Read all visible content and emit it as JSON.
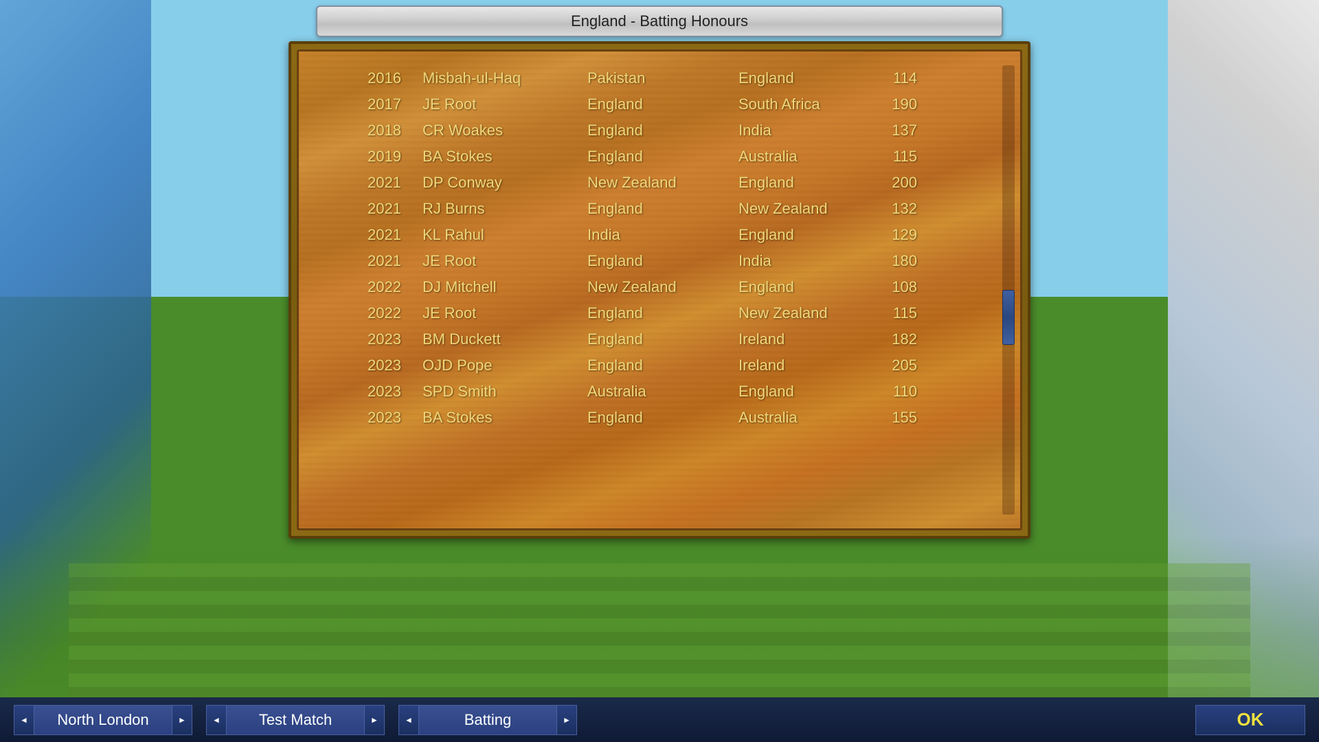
{
  "title": "England - Batting Honours",
  "records": [
    {
      "year": "2016",
      "player": "Misbah-ul-Haq",
      "team1": "Pakistan",
      "team2": "England",
      "score": "114"
    },
    {
      "year": "2017",
      "player": "JE Root",
      "team1": "England",
      "team2": "South Africa",
      "score": "190"
    },
    {
      "year": "2018",
      "player": "CR Woakes",
      "team1": "England",
      "team2": "India",
      "score": "137"
    },
    {
      "year": "2019",
      "player": "BA Stokes",
      "team1": "England",
      "team2": "Australia",
      "score": "115"
    },
    {
      "year": "2021",
      "player": "DP Conway",
      "team1": "New Zealand",
      "team2": "England",
      "score": "200"
    },
    {
      "year": "2021",
      "player": "RJ Burns",
      "team1": "England",
      "team2": "New Zealand",
      "score": "132"
    },
    {
      "year": "2021",
      "player": "KL Rahul",
      "team1": "India",
      "team2": "England",
      "score": "129"
    },
    {
      "year": "2021",
      "player": "JE Root",
      "team1": "England",
      "team2": "India",
      "score": "180"
    },
    {
      "year": "2022",
      "player": "DJ Mitchell",
      "team1": "New Zealand",
      "team2": "England",
      "score": "108"
    },
    {
      "year": "2022",
      "player": "JE Root",
      "team1": "England",
      "team2": "New Zealand",
      "score": "115"
    },
    {
      "year": "2023",
      "player": "BM Duckett",
      "team1": "England",
      "team2": "Ireland",
      "score": "182"
    },
    {
      "year": "2023",
      "player": "OJD Pope",
      "team1": "England",
      "team2": "Ireland",
      "score": "205"
    },
    {
      "year": "2023",
      "player": "SPD Smith",
      "team1": "Australia",
      "team2": "England",
      "score": "110"
    },
    {
      "year": "2023",
      "player": "BA Stokes",
      "team1": "England",
      "team2": "Australia",
      "score": "155"
    }
  ],
  "bottom_bar": {
    "venue_label": "North London",
    "match_type_label": "Test Match",
    "category_label": "Batting",
    "ok_label": "OK",
    "venue_arrow_left": "◄",
    "venue_arrow_right": "►",
    "match_arrow_left": "◄",
    "match_arrow_right": "►",
    "category_arrow_left": "◄",
    "category_arrow_right": "►"
  }
}
